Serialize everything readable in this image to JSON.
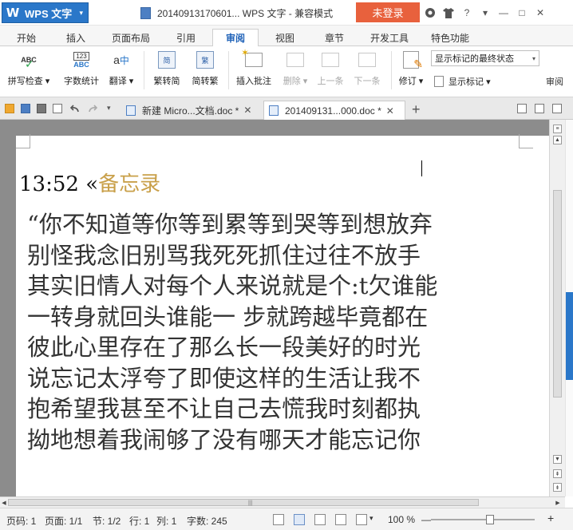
{
  "titlebar": {
    "app_name": "WPS 文字",
    "app_logo": "W",
    "doc_title": "20140913170601... WPS 文字 - 兼容模式",
    "login_label": "未登录",
    "icons": [
      "skin-icon",
      "shirt-icon",
      "help-icon",
      "menu-caret-icon",
      "minimize-icon",
      "maximize-icon",
      "close-icon"
    ],
    "help_symbol": "?",
    "caret_symbol": "▾",
    "minimize_symbol": "—",
    "maximize_symbol": "□",
    "close_symbol": "✕"
  },
  "tabs": [
    {
      "label": "开始",
      "active": false
    },
    {
      "label": "插入",
      "active": false
    },
    {
      "label": "页面布局",
      "active": false
    },
    {
      "label": "引用",
      "active": false
    },
    {
      "label": "审阅",
      "active": true
    },
    {
      "label": "视图",
      "active": false
    },
    {
      "label": "章节",
      "active": false
    },
    {
      "label": "开发工具",
      "active": false
    },
    {
      "label": "特色功能",
      "active": false
    }
  ],
  "ribbon": {
    "spell_check": "拼写检查",
    "word_count": "字数统计",
    "translate": "翻译",
    "to_traditional": "繁转简",
    "to_simplified": "简转繁",
    "insert_comment": "插入批注",
    "delete": "删除",
    "prev": "上一条",
    "next": "下一条",
    "revise": "修订",
    "show_state": "显示标记的最终状态",
    "show_marks": "显示标记",
    "review_more": "审阅",
    "abc_text": "ABC",
    "num_text": "123",
    "a_text": "a",
    "translate_glyph": "中",
    "jian": "简",
    "fan": "繁",
    "check_mark": "✓",
    "dropdown_caret": "▾"
  },
  "doc_tabs": [
    {
      "label": "新建 Micro...文档.doc *",
      "active": false
    },
    {
      "label": "20140913​1...000.doc *",
      "active": true
    }
  ],
  "doc_tab_close": "✕",
  "new_tab": "+",
  "document": {
    "heading_time": "13:52",
    "heading_mark": " «",
    "heading_memo": "备忘录",
    "lines": [
      "“你不知道等你等到累等到哭等到想放弃",
      "别怪我念旧别骂我死死抓住过往不放手",
      "其实旧情人对每个人来说就是个:t欠谁能",
      "一转身就回头谁能一 步就跨越毕竟都在",
      "彼此心里存在了那么长一段美好的时光",
      "说忘记太浮夸了即使这样的生活让我不",
      "抱希望我甚至不让自己去慌我时刻都执",
      "拗地想着我闹够了没有哪天才能忘记你"
    ]
  },
  "scroll": {
    "up": "▲",
    "down": "▼",
    "page_up": "⇞",
    "page_down": "⇟",
    "grip_v": "≡",
    "grip_h": "|||",
    "left": "◀",
    "right": "▶"
  },
  "status": {
    "page_code": "页码: 1",
    "page": "页面: 1/1",
    "section": "节: 1/2",
    "row": "行: 1",
    "col": "列: 1",
    "chars": "字数: 245",
    "zoom": "100 %",
    "zoom_value": 100,
    "minus": "—",
    "plus": "+",
    "caret": "▾"
  },
  "colors": {
    "app_blue": "#2a77c9",
    "login_orange": "#e8613d",
    "active_tab_text": "#1f62b8",
    "memo_gold": "#c9a04a",
    "doc_gray": "#8c8c8c",
    "paper": "#ffffff",
    "text": "#333333"
  }
}
